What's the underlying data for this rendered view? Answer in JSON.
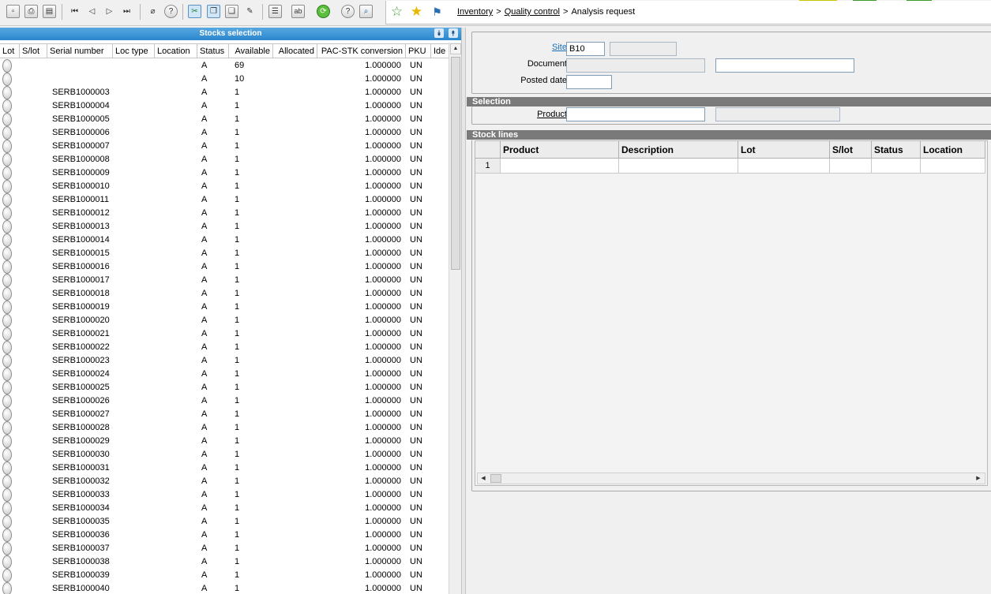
{
  "toolbar": {
    "icons": [
      "new-icon",
      "print-icon",
      "save-icon",
      "first-record-icon",
      "previous-record-icon",
      "next-record-icon",
      "last-record-icon",
      "attachment-icon",
      "help-icon",
      "cut-icon",
      "copy-icon",
      "paste-icon",
      "edit-icon",
      "table-icon",
      "text-field-icon",
      "refresh-icon",
      "info-icon",
      "search-icon"
    ],
    "favorites_icons": [
      "add-favorite-icon",
      "favorite-star-icon",
      "signpost-icon"
    ]
  },
  "breadcrumb": {
    "level1": "Inventory",
    "sep1": ">",
    "level2": "Quality control",
    "sep2": ">",
    "current": "Analysis request"
  },
  "stocks_selection": {
    "title": "Stocks selection",
    "columns": [
      "Lot",
      "S/lot",
      "Serial number",
      "Loc type",
      "Location",
      "Status",
      "Available",
      "Allocated",
      "PAC-STK conversion",
      "PKU",
      "Ide"
    ],
    "rows": [
      {
        "serial": "",
        "status": "A",
        "available": "69",
        "conversion": "1.000000",
        "pku": "UN"
      },
      {
        "serial": "",
        "status": "A",
        "available": "10",
        "conversion": "1.000000",
        "pku": "UN"
      },
      {
        "serial": "SERB1000003",
        "status": "A",
        "available": "1",
        "conversion": "1.000000",
        "pku": "UN"
      },
      {
        "serial": "SERB1000004",
        "status": "A",
        "available": "1",
        "conversion": "1.000000",
        "pku": "UN"
      },
      {
        "serial": "SERB1000005",
        "status": "A",
        "available": "1",
        "conversion": "1.000000",
        "pku": "UN"
      },
      {
        "serial": "SERB1000006",
        "status": "A",
        "available": "1",
        "conversion": "1.000000",
        "pku": "UN"
      },
      {
        "serial": "SERB1000007",
        "status": "A",
        "available": "1",
        "conversion": "1.000000",
        "pku": "UN"
      },
      {
        "serial": "SERB1000008",
        "status": "A",
        "available": "1",
        "conversion": "1.000000",
        "pku": "UN"
      },
      {
        "serial": "SERB1000009",
        "status": "A",
        "available": "1",
        "conversion": "1.000000",
        "pku": "UN"
      },
      {
        "serial": "SERB1000010",
        "status": "A",
        "available": "1",
        "conversion": "1.000000",
        "pku": "UN"
      },
      {
        "serial": "SERB1000011",
        "status": "A",
        "available": "1",
        "conversion": "1.000000",
        "pku": "UN"
      },
      {
        "serial": "SERB1000012",
        "status": "A",
        "available": "1",
        "conversion": "1.000000",
        "pku": "UN"
      },
      {
        "serial": "SERB1000013",
        "status": "A",
        "available": "1",
        "conversion": "1.000000",
        "pku": "UN"
      },
      {
        "serial": "SERB1000014",
        "status": "A",
        "available": "1",
        "conversion": "1.000000",
        "pku": "UN"
      },
      {
        "serial": "SERB1000015",
        "status": "A",
        "available": "1",
        "conversion": "1.000000",
        "pku": "UN"
      },
      {
        "serial": "SERB1000016",
        "status": "A",
        "available": "1",
        "conversion": "1.000000",
        "pku": "UN"
      },
      {
        "serial": "SERB1000017",
        "status": "A",
        "available": "1",
        "conversion": "1.000000",
        "pku": "UN"
      },
      {
        "serial": "SERB1000018",
        "status": "A",
        "available": "1",
        "conversion": "1.000000",
        "pku": "UN"
      },
      {
        "serial": "SERB1000019",
        "status": "A",
        "available": "1",
        "conversion": "1.000000",
        "pku": "UN"
      },
      {
        "serial": "SERB1000020",
        "status": "A",
        "available": "1",
        "conversion": "1.000000",
        "pku": "UN"
      },
      {
        "serial": "SERB1000021",
        "status": "A",
        "available": "1",
        "conversion": "1.000000",
        "pku": "UN"
      },
      {
        "serial": "SERB1000022",
        "status": "A",
        "available": "1",
        "conversion": "1.000000",
        "pku": "UN"
      },
      {
        "serial": "SERB1000023",
        "status": "A",
        "available": "1",
        "conversion": "1.000000",
        "pku": "UN"
      },
      {
        "serial": "SERB1000024",
        "status": "A",
        "available": "1",
        "conversion": "1.000000",
        "pku": "UN"
      },
      {
        "serial": "SERB1000025",
        "status": "A",
        "available": "1",
        "conversion": "1.000000",
        "pku": "UN"
      },
      {
        "serial": "SERB1000026",
        "status": "A",
        "available": "1",
        "conversion": "1.000000",
        "pku": "UN"
      },
      {
        "serial": "SERB1000027",
        "status": "A",
        "available": "1",
        "conversion": "1.000000",
        "pku": "UN"
      },
      {
        "serial": "SERB1000028",
        "status": "A",
        "available": "1",
        "conversion": "1.000000",
        "pku": "UN"
      },
      {
        "serial": "SERB1000029",
        "status": "A",
        "available": "1",
        "conversion": "1.000000",
        "pku": "UN"
      },
      {
        "serial": "SERB1000030",
        "status": "A",
        "available": "1",
        "conversion": "1.000000",
        "pku": "UN"
      },
      {
        "serial": "SERB1000031",
        "status": "A",
        "available": "1",
        "conversion": "1.000000",
        "pku": "UN"
      },
      {
        "serial": "SERB1000032",
        "status": "A",
        "available": "1",
        "conversion": "1.000000",
        "pku": "UN"
      },
      {
        "serial": "SERB1000033",
        "status": "A",
        "available": "1",
        "conversion": "1.000000",
        "pku": "UN"
      },
      {
        "serial": "SERB1000034",
        "status": "A",
        "available": "1",
        "conversion": "1.000000",
        "pku": "UN"
      },
      {
        "serial": "SERB1000035",
        "status": "A",
        "available": "1",
        "conversion": "1.000000",
        "pku": "UN"
      },
      {
        "serial": "SERB1000036",
        "status": "A",
        "available": "1",
        "conversion": "1.000000",
        "pku": "UN"
      },
      {
        "serial": "SERB1000037",
        "status": "A",
        "available": "1",
        "conversion": "1.000000",
        "pku": "UN"
      },
      {
        "serial": "SERB1000038",
        "status": "A",
        "available": "1",
        "conversion": "1.000000",
        "pku": "UN"
      },
      {
        "serial": "SERB1000039",
        "status": "A",
        "available": "1",
        "conversion": "1.000000",
        "pku": "UN"
      },
      {
        "serial": "SERB1000040",
        "status": "A",
        "available": "1",
        "conversion": "1.000000",
        "pku": "UN"
      }
    ]
  },
  "form": {
    "site_label": "Site",
    "site_value": "B10",
    "document_label": "Document",
    "posted_date_label": "Posted date",
    "selection_section": "Selection",
    "product_label": "Product",
    "stock_lines_section": "Stock lines",
    "stock_lines_columns": [
      "Product",
      "Description",
      "Lot",
      "S/lot",
      "Status",
      "Location"
    ],
    "stock_lines_row_number": "1"
  },
  "colors": {
    "accent_blue": "#2b86cc",
    "section_gray": "#7a7a7a",
    "link_blue": "#1a6fb8"
  }
}
